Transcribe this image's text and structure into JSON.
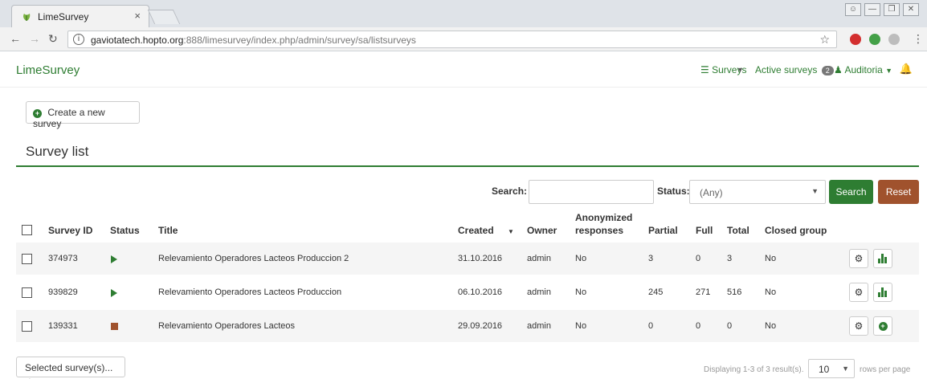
{
  "browser": {
    "tab_title": "LimeSurvey",
    "tab_close": "×",
    "url_info": "i",
    "url_host": "gaviotatech.hopto.org",
    "url_rest": ":888/limesurvey/index.php/admin/survey/sa/listsurveys",
    "ext_colors": [
      "#d32f2f",
      "#43a047",
      "#9e9e9e"
    ]
  },
  "navbar": {
    "brand": "LimeSurvey",
    "surveys_label": "Surveys",
    "active_surveys_label": "Active surveys",
    "active_surveys_count": "2",
    "user_label": "Auditoria"
  },
  "toolbar": {
    "create_label": "Create a new survey"
  },
  "page": {
    "title": "Survey list"
  },
  "filters": {
    "search_label": "Search:",
    "search_value": "",
    "status_label": "Status:",
    "status_value": "(Any)",
    "search_button": "Search",
    "reset_button": "Reset"
  },
  "table": {
    "headers": {
      "survey_id": "Survey ID",
      "status": "Status",
      "title": "Title",
      "created": "Created",
      "owner": "Owner",
      "anonymized_1": "Anonymized",
      "anonymized_2": "responses",
      "partial": "Partial",
      "full": "Full",
      "total": "Total",
      "closed_group": "Closed group"
    },
    "rows": [
      {
        "id": "374973",
        "status": "active",
        "title": "Relevamiento Operadores Lacteos Produccion 2",
        "created": "31.10.2016",
        "owner": "admin",
        "anonymized": "No",
        "partial": "3",
        "full": "0",
        "total": "3",
        "closed_group": "No",
        "second_action": "statistics"
      },
      {
        "id": "939829",
        "status": "active",
        "title": "Relevamiento Operadores Lacteos Produccion",
        "created": "06.10.2016",
        "owner": "admin",
        "anonymized": "No",
        "partial": "245",
        "full": "271",
        "total": "516",
        "closed_group": "No",
        "second_action": "statistics"
      },
      {
        "id": "139331",
        "status": "stopped",
        "title": "Relevamiento Operadores Lacteos",
        "created": "29.09.2016",
        "owner": "admin",
        "anonymized": "No",
        "partial": "0",
        "full": "0",
        "total": "0",
        "closed_group": "No",
        "second_action": "add"
      }
    ]
  },
  "footer": {
    "selected_label": "Selected survey(s)...",
    "displaying": "Displaying 1-3 of 3 result(s).",
    "rows_value": "10",
    "rows_label": "rows per page"
  },
  "colors": {
    "accent": "#2e7d32",
    "reset": "#a0522d"
  }
}
